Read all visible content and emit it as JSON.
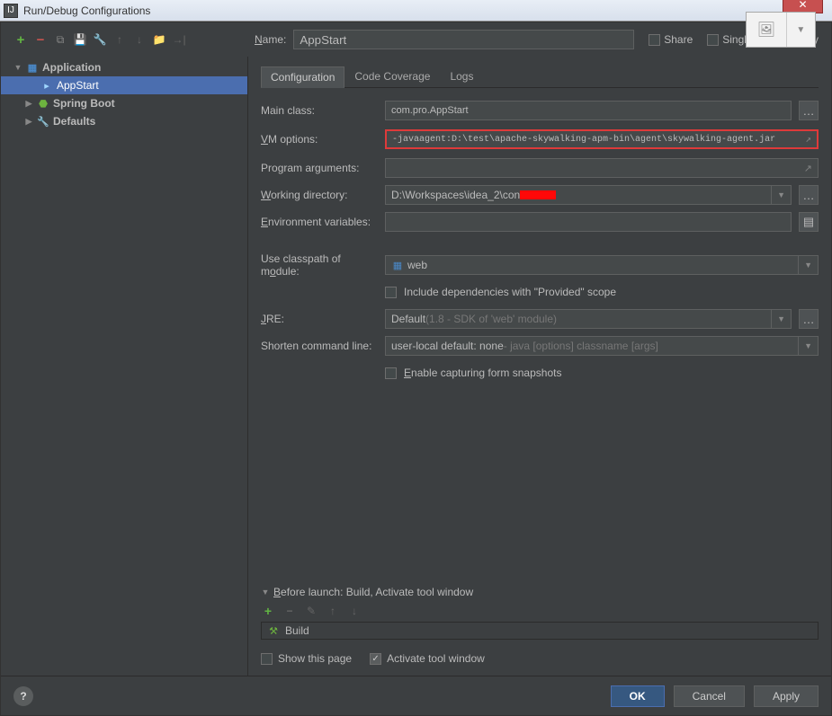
{
  "titlebar": {
    "title": "Run/Debug Configurations"
  },
  "toolbar": {
    "overlay_text": "Single instance only"
  },
  "header": {
    "name_label": "Name:",
    "name_value": "AppStart",
    "share_label": "Share",
    "single_instance_label": "Single instance only"
  },
  "tree": {
    "application": "Application",
    "appstart": "AppStart",
    "spring_boot": "Spring Boot",
    "defaults": "Defaults"
  },
  "tabs": {
    "configuration": "Configuration",
    "code_coverage": "Code Coverage",
    "logs": "Logs"
  },
  "form": {
    "main_class_label": "Main class:",
    "main_class_value": "com.pro.AppStart",
    "vm_options_label": "VM options:",
    "vm_options_value": "-javaagent:D:\\test\\apache-skywalking-apm-bin\\agent\\skywalking-agent.jar",
    "program_args_label": "Program arguments:",
    "program_args_value": "",
    "working_dir_label": "Working directory:",
    "working_dir_value_prefix": "D:\\Workspaces\\idea_2\\con",
    "env_vars_label": "Environment variables:",
    "env_vars_value": "",
    "classpath_label": "Use classpath of module:",
    "classpath_value": "web",
    "include_deps_label": "Include dependencies with \"Provided\" scope",
    "jre_label": "JRE:",
    "jre_value_prefix": "Default ",
    "jre_value_dim": "(1.8 - SDK of 'web' module)",
    "shorten_label": "Shorten command line:",
    "shorten_value_prefix": "user-local default: none ",
    "shorten_value_dim": "- java [options] classname [args]",
    "enable_capture_label": "Enable capturing form snapshots"
  },
  "before_launch": {
    "title": "Before launch: Build, Activate tool window",
    "build_item": "Build",
    "show_page_label": "Show this page",
    "activate_label": "Activate tool window"
  },
  "footer": {
    "ok": "OK",
    "cancel": "Cancel",
    "apply": "Apply"
  }
}
